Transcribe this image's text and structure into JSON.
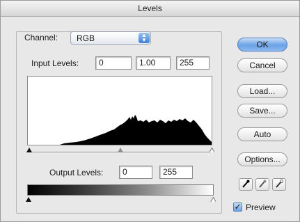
{
  "window": {
    "title": "Levels"
  },
  "channel": {
    "label": "Channel:",
    "value": "RGB"
  },
  "input_levels": {
    "label": "Input Levels:",
    "black": "0",
    "gamma": "1.00",
    "white": "255"
  },
  "output_levels": {
    "label": "Output Levels:",
    "black": "0",
    "white": "255"
  },
  "buttons": {
    "ok": "OK",
    "cancel": "Cancel",
    "load": "Load...",
    "save": "Save...",
    "auto": "Auto",
    "options": "Options..."
  },
  "droppers": [
    "black-eyedropper",
    "gray-eyedropper",
    "white-eyedropper"
  ],
  "preview": {
    "label": "Preview",
    "checked": true
  },
  "colors": {
    "accent": "#6aa2e6",
    "histogram": "#000000"
  }
}
